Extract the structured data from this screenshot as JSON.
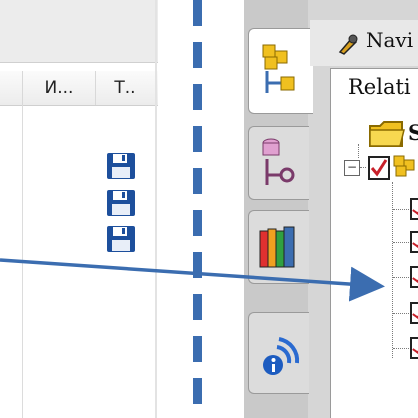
{
  "table": {
    "columns": [
      {
        "label": "И..."
      },
      {
        "label": "Т.."
      }
    ],
    "rows": [
      {
        "type_icon": "floppy-disk-icon"
      },
      {
        "type_icon": "floppy-disk-icon"
      },
      {
        "type_icon": "floppy-disk-icon"
      }
    ]
  },
  "navigator": {
    "title": "Navi",
    "title_icon": "pencil-wrench-icon",
    "relations_tab_label": "Relati",
    "tree": {
      "root_label": "S",
      "root_icon": "folder-icon",
      "expander_symbol": "−"
    }
  },
  "side_tabs": [
    {
      "icon": "assembly-structure-icon"
    },
    {
      "icon": "database-relation-icon"
    },
    {
      "icon": "books-library-icon"
    },
    {
      "icon": "info-signal-icon"
    }
  ],
  "colors": {
    "accent_blue": "#3b6db0",
    "check_red": "#c8202a",
    "folder_yellow": "#f0c020"
  }
}
